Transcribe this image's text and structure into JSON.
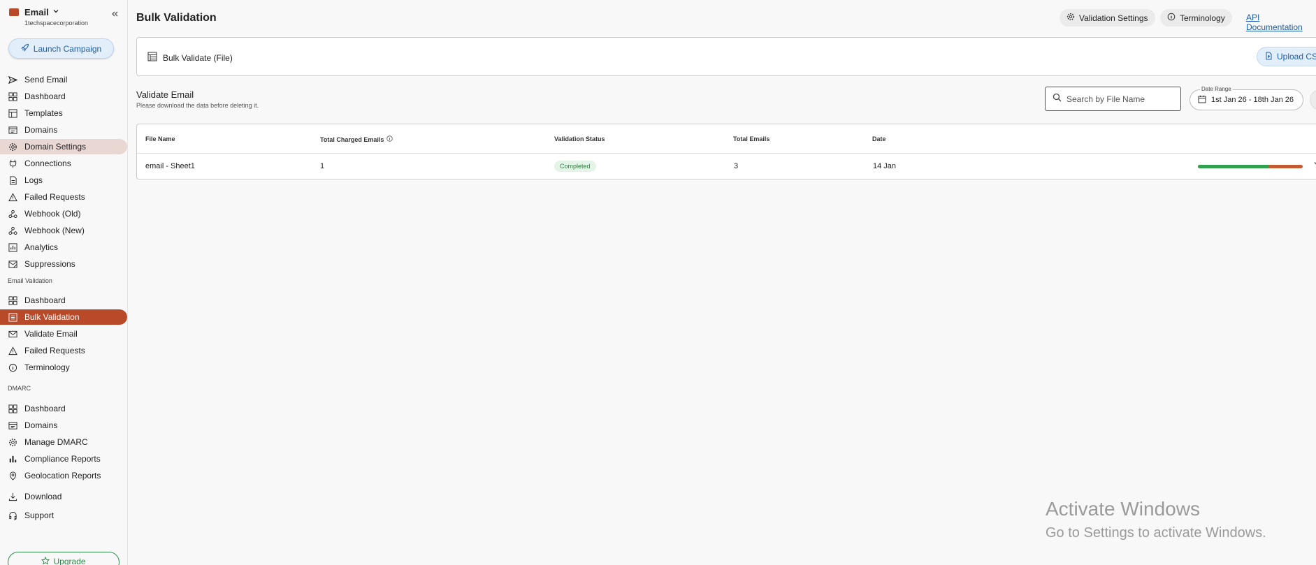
{
  "sidebar": {
    "brand": {
      "name": "Email",
      "org": "1techspacecorporation"
    },
    "launch_label": "Launch Campaign",
    "items": [
      {
        "label": "Send Email",
        "icon": "send-icon"
      },
      {
        "label": "Dashboard",
        "icon": "dashboard-icon"
      },
      {
        "label": "Templates",
        "icon": "templates-icon"
      },
      {
        "label": "Domains",
        "icon": "domains-icon"
      },
      {
        "label": "Domain Settings",
        "icon": "gear-icon"
      },
      {
        "label": "Connections",
        "icon": "plug-icon"
      },
      {
        "label": "Logs",
        "icon": "logs-icon"
      },
      {
        "label": "Failed Requests",
        "icon": "warning-icon"
      },
      {
        "label": "Webhook (Old)",
        "icon": "webhook-icon"
      },
      {
        "label": "Webhook (New)",
        "icon": "webhook-icon"
      },
      {
        "label": "Analytics",
        "icon": "analytics-icon"
      },
      {
        "label": "Suppressions",
        "icon": "suppressions-icon"
      }
    ],
    "validation_section": "Email Validation",
    "validation_items": [
      {
        "label": "Dashboard",
        "icon": "dashboard-icon"
      },
      {
        "label": "Bulk Validation",
        "icon": "bulk-list-icon"
      },
      {
        "label": "Validate Email",
        "icon": "mail-icon"
      },
      {
        "label": "Failed Requests",
        "icon": "warning-icon"
      },
      {
        "label": "Terminology",
        "icon": "info-icon"
      }
    ],
    "dmarc_section": "DMARC",
    "dmarc_items": [
      {
        "label": "Dashboard",
        "icon": "dashboard-icon"
      },
      {
        "label": "Domains",
        "icon": "domains-icon"
      },
      {
        "label": "Manage DMARC",
        "icon": "gear-icon"
      },
      {
        "label": "Compliance Reports",
        "icon": "bar-chart-icon"
      },
      {
        "label": "Geolocation Reports",
        "icon": "location-pin-icon"
      }
    ],
    "footer_items": [
      {
        "label": "Download",
        "icon": "download-icon"
      },
      {
        "label": "Support",
        "icon": "headset-icon"
      }
    ],
    "upgrade_label": "Upgrade"
  },
  "header": {
    "title": "Bulk Validation",
    "validation_settings": "Validation Settings",
    "terminology": "Terminology",
    "api_docs": "API Documentation"
  },
  "file_card": {
    "title": "Bulk Validate (File)",
    "upload_label": "Upload CSV"
  },
  "section": {
    "title": "Validate Email",
    "subtitle": "Please download the data before deleting it."
  },
  "search": {
    "placeholder": "Search by File Name"
  },
  "date_range": {
    "label": "Date Range",
    "value": "1st Jan 26 - 18th Jan 26"
  },
  "table": {
    "headers": [
      "File Name",
      "Total Charged Emails",
      "Validation Status",
      "Total Emails",
      "Date"
    ],
    "rows": [
      {
        "file_name": "email - Sheet1",
        "charged": "1",
        "status": "Completed",
        "total": "3",
        "date": "14 Jan",
        "valid_fraction": 0.67
      }
    ]
  },
  "colors": {
    "accent": "#b84a2a",
    "link": "#1e5fa8",
    "success": "#2fa14f"
  },
  "watermark": {
    "line1": "Activate Windows",
    "line2": "Go to Settings to activate Windows."
  }
}
